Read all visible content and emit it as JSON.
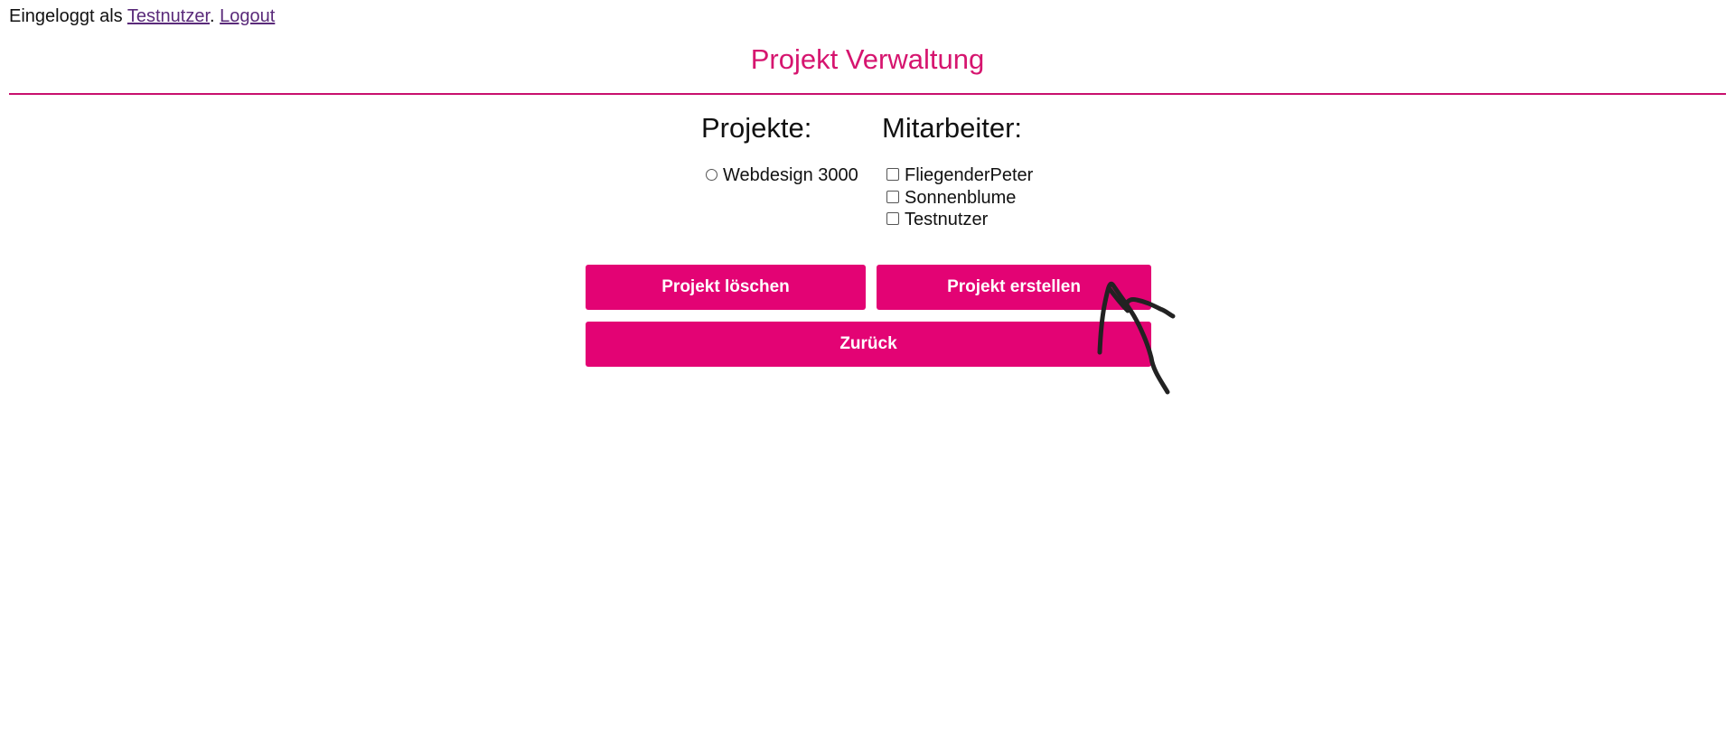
{
  "header": {
    "login_prefix": "Eingeloggt als",
    "username": "Testnutzer",
    "separator": ".",
    "logout_label": "Logout"
  },
  "page_title": "Projekt Verwaltung",
  "projects": {
    "heading": "Projekte:",
    "items": [
      "Webdesign 3000"
    ]
  },
  "staff": {
    "heading": "Mitarbeiter:",
    "items": [
      "FliegenderPeter",
      "Sonnenblume",
      "Testnutzer"
    ]
  },
  "buttons": {
    "delete_label": "Projekt löschen",
    "create_label": "Projekt erstellen",
    "back_label": "Zurück"
  },
  "colors": {
    "accent": "#e30374",
    "title": "#d6156f",
    "link": "#5a2a7a",
    "annotation": "#222222"
  }
}
